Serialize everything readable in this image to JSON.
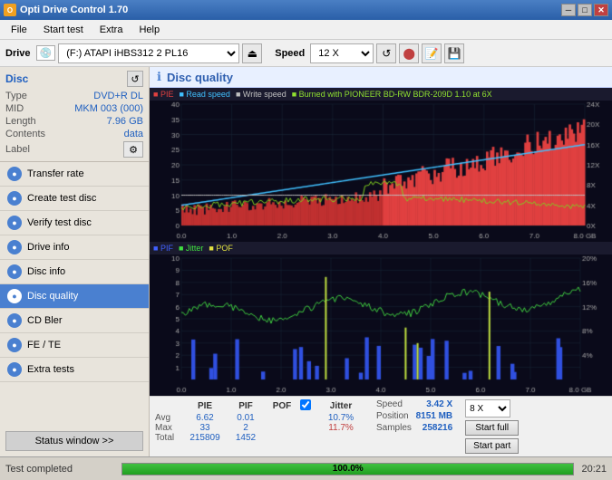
{
  "titleBar": {
    "title": "Opti Drive Control 1.70",
    "minimizeBtn": "─",
    "maximizeBtn": "□",
    "closeBtn": "✕"
  },
  "menuBar": {
    "items": [
      "File",
      "Start test",
      "Extra",
      "Help"
    ]
  },
  "driveBar": {
    "driveLabel": "Drive",
    "driveValue": "(F:)  ATAPI iHBS312  2 PL16",
    "speedLabel": "Speed",
    "speedValue": "12 X"
  },
  "disc": {
    "title": "Disc",
    "typeLabel": "Type",
    "typeValue": "DVD+R DL",
    "midLabel": "MID",
    "midValue": "MKM 003 (000)",
    "lengthLabel": "Length",
    "lengthValue": "7.96 GB",
    "contentsLabel": "Contents",
    "contentsValue": "data",
    "labelLabel": "Label"
  },
  "nav": {
    "items": [
      {
        "label": "Transfer rate",
        "active": false
      },
      {
        "label": "Create test disc",
        "active": false
      },
      {
        "label": "Verify test disc",
        "active": false
      },
      {
        "label": "Drive info",
        "active": false
      },
      {
        "label": "Disc info",
        "active": false
      },
      {
        "label": "Disc quality",
        "active": true
      },
      {
        "label": "CD Bler",
        "active": false
      },
      {
        "label": "FE / TE",
        "active": false
      },
      {
        "label": "Extra tests",
        "active": false
      }
    ],
    "statusBtn": "Status window >>"
  },
  "discQuality": {
    "title": "Disc quality",
    "legend": [
      {
        "label": "PIE",
        "color": "#e04040"
      },
      {
        "label": "Read speed",
        "color": "#40c0ff"
      },
      {
        "label": "Write speed",
        "color": "#c0c0c0"
      },
      {
        "label": "Burned with PIONEER BD-RW  BDR-209D 1.10 at 6X",
        "color": "#90e030"
      }
    ],
    "legend2": [
      {
        "label": "PIF",
        "color": "#4060ff"
      },
      {
        "label": "Jitter",
        "color": "#40e040"
      },
      {
        "label": "POF",
        "color": "#e0e040"
      }
    ]
  },
  "stats": {
    "headers": [
      "PIE",
      "PIF",
      "POF",
      "",
      "Jitter",
      "Speed",
      ""
    ],
    "avgLabel": "Avg",
    "maxLabel": "Max",
    "totalLabel": "Total",
    "avgPIE": "6.62",
    "avgPIF": "0.01",
    "avgPOF": "",
    "avgJitter": "10.7%",
    "maxPIE": "33",
    "maxPIF": "2",
    "maxPOF": "",
    "maxJitter": "11.7%",
    "totalPIE": "215809",
    "totalPIF": "1452",
    "speedLabel": "Speed",
    "speedVal": "3.42 X",
    "positionLabel": "Position",
    "positionVal": "8151 MB",
    "samplesLabel": "Samples",
    "samplesVal": "258216",
    "jitterChecked": true,
    "speedCombo": "8 X",
    "startFullBtn": "Start full",
    "startPartBtn": "Start part"
  },
  "statusBar": {
    "text": "Test completed",
    "progress": "100.0%",
    "time": "20:21"
  }
}
